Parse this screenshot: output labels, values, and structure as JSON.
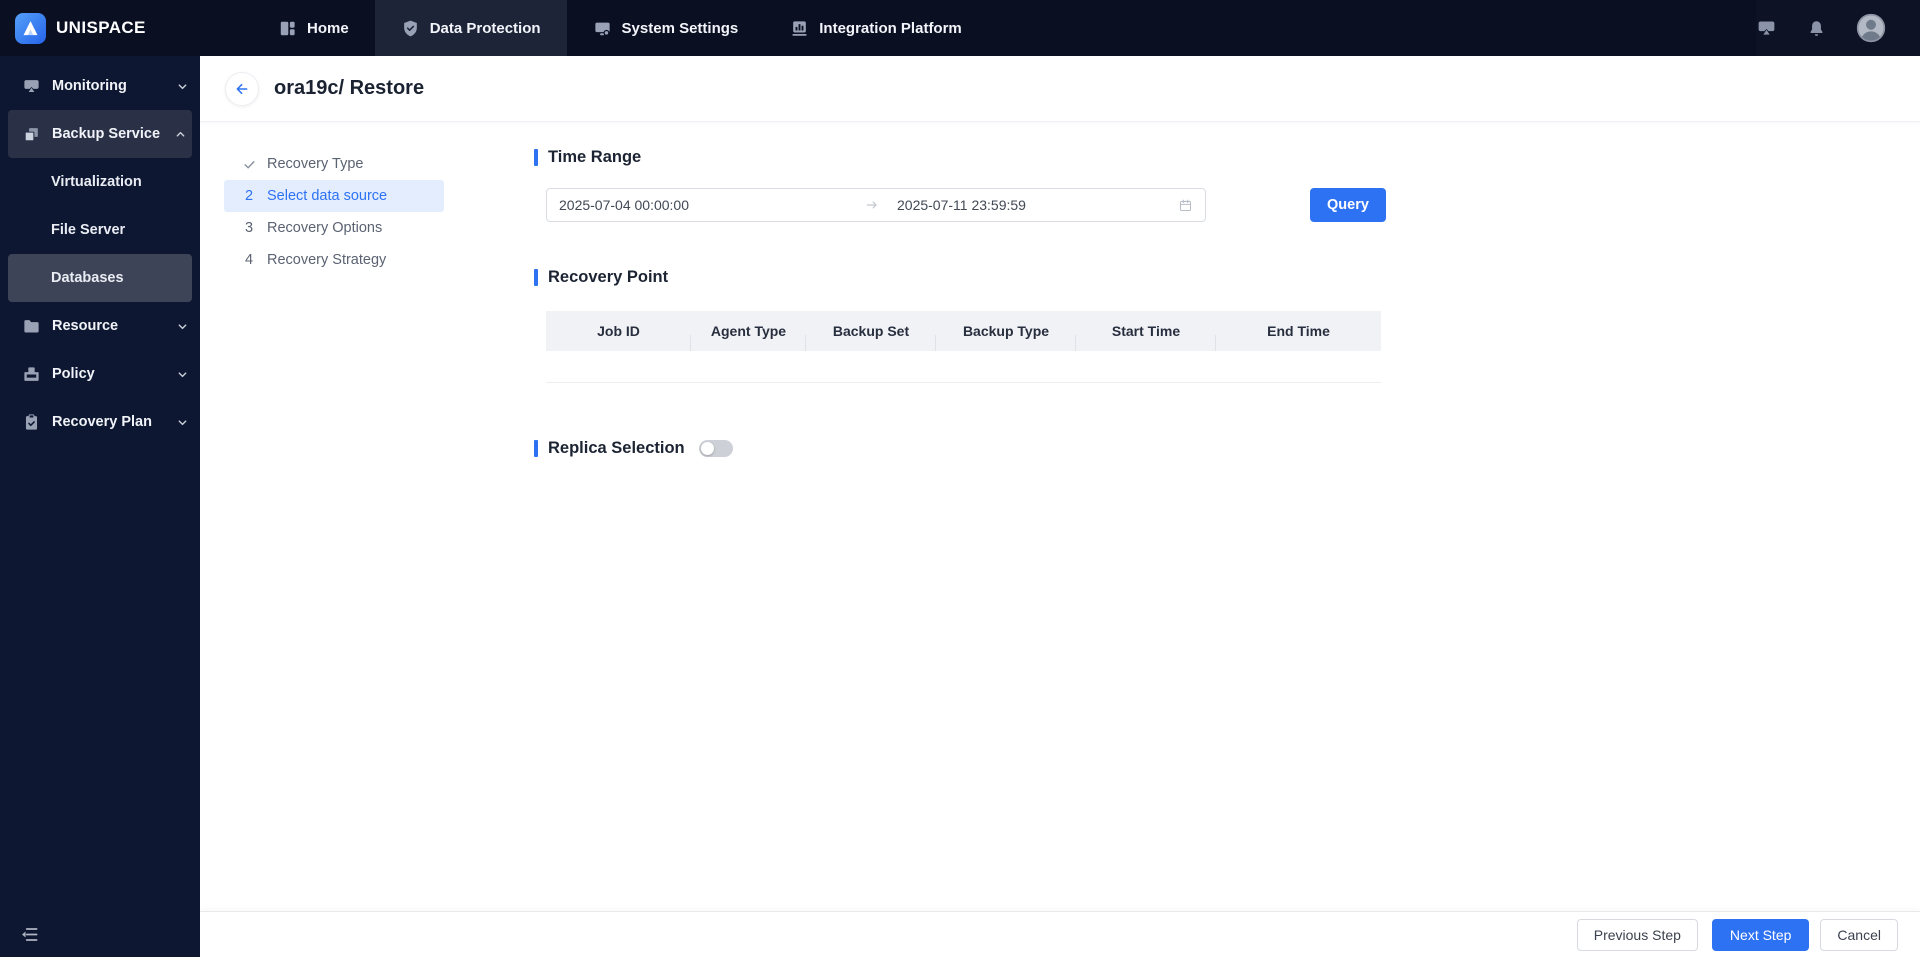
{
  "app": {
    "brand": "UNISPACE"
  },
  "navbar": {
    "tabs": [
      {
        "label": "Home",
        "icon": "home-icon"
      },
      {
        "label": "Data Protection",
        "icon": "shield-icon",
        "active": true
      },
      {
        "label": "System Settings",
        "icon": "monitor-icon"
      },
      {
        "label": "Integration Platform",
        "icon": "bar-chart-icon"
      }
    ],
    "right_icons": [
      "message-icon",
      "bell-icon",
      "avatar"
    ]
  },
  "sidebar": {
    "items": [
      {
        "label": "Monitoring",
        "icon": "airplay-icon",
        "chevron": "down"
      },
      {
        "label": "Backup Service",
        "icon": "copy-icon",
        "chevron": "up",
        "state": "expanded-active"
      },
      {
        "label": "Virtualization",
        "child": true
      },
      {
        "label": "File Server",
        "child": true
      },
      {
        "label": "Databases",
        "child": true,
        "state": "selected"
      },
      {
        "label": "Resource",
        "icon": "folder-icon",
        "chevron": "down"
      },
      {
        "label": "Policy",
        "icon": "inbox-icon",
        "chevron": "down"
      },
      {
        "label": "Recovery Plan",
        "icon": "clipboard-icon",
        "chevron": "down"
      }
    ]
  },
  "page": {
    "title": "ora19c/ Restore"
  },
  "wizard": {
    "steps": [
      {
        "marker": "check",
        "label": "Recovery Type",
        "done": true
      },
      {
        "marker": "2",
        "label": "Select data source",
        "active": true
      },
      {
        "marker": "3",
        "label": "Recovery Options"
      },
      {
        "marker": "4",
        "label": "Recovery Strategy"
      }
    ]
  },
  "time_range": {
    "title": "Time Range",
    "start": "2025-07-04 00:00:00",
    "end": "2025-07-11 23:59:59",
    "query_label": "Query"
  },
  "recovery_point": {
    "title": "Recovery Point",
    "columns": [
      "Job ID",
      "Agent Type",
      "Backup Set",
      "Backup Type",
      "Start Time",
      "End Time"
    ],
    "rows": []
  },
  "replica_selection": {
    "title": "Replica Selection",
    "toggle_on": false
  },
  "footer": {
    "previous_label": "Previous Step",
    "next_label": "Next Step",
    "cancel_label": "Cancel"
  },
  "colors": {
    "accent_blue": "#2e72f4",
    "navbar_bg": "#0a0f22",
    "sidebar_bg": "#0d1731",
    "active_step_bg": "#e3edfd",
    "table_header_bg": "#f1f2f5",
    "toggle_off": "#cdd0d6"
  }
}
